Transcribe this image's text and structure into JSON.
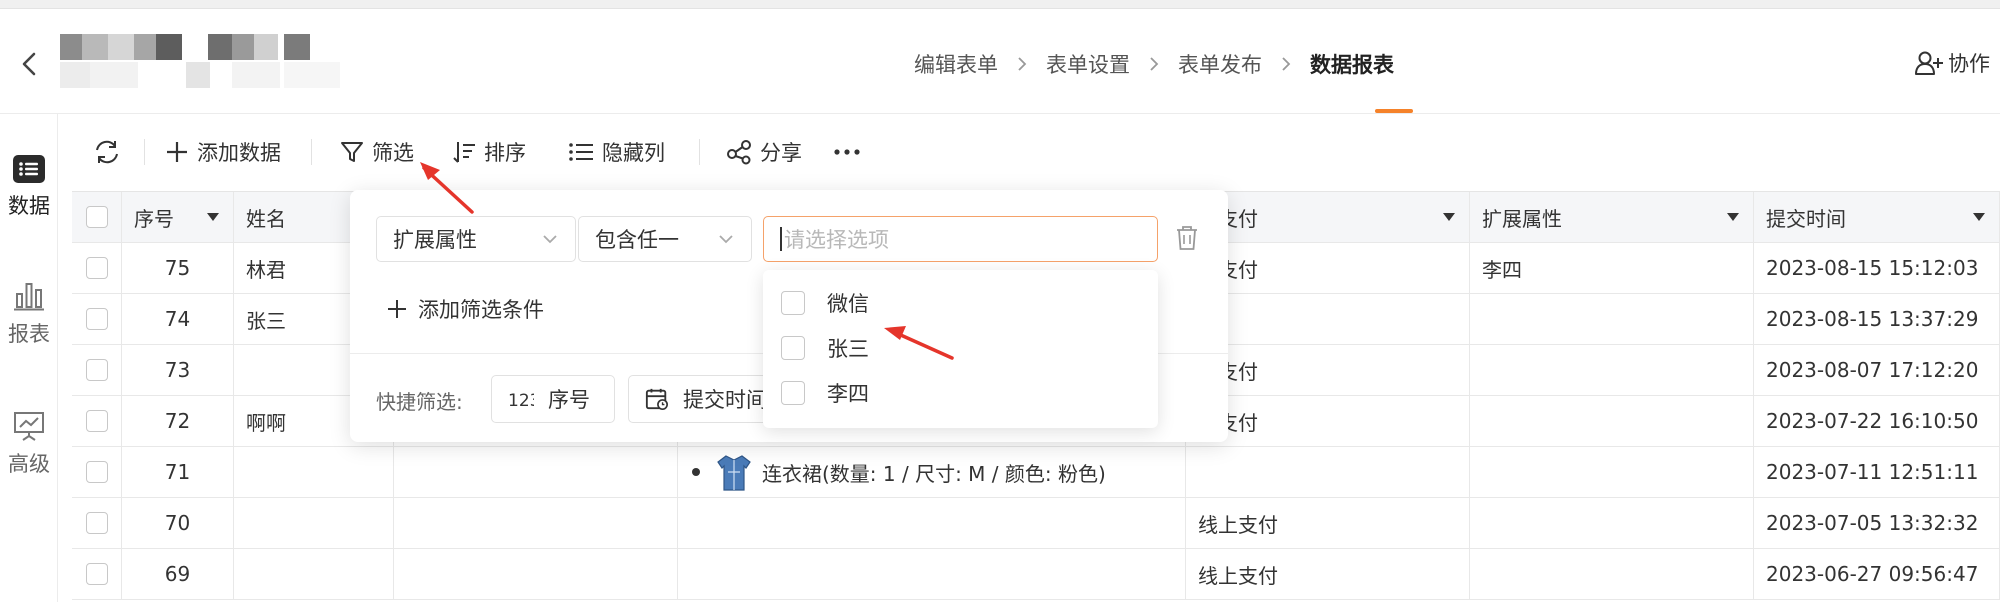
{
  "header": {
    "nav_steps": [
      "编辑表单",
      "表单设置",
      "表单发布",
      "数据报表"
    ],
    "active_step": "数据报表",
    "collab_label": "协作"
  },
  "sidebar": {
    "items": [
      {
        "label": "数据",
        "icon": "list-icon",
        "active": true
      },
      {
        "label": "报表",
        "icon": "bar-chart-icon",
        "active": false
      },
      {
        "label": "高级",
        "icon": "presentation-icon",
        "active": false
      }
    ]
  },
  "toolbar": {
    "add_data": "添加数据",
    "filter": "筛选",
    "sort": "排序",
    "hide_columns": "隐藏列",
    "share": "分享"
  },
  "table": {
    "columns": [
      "序号",
      "姓名",
      "",
      "",
      "何支付",
      "扩展属性",
      "提交时间"
    ],
    "rows": [
      {
        "seq": "75",
        "name": "林君",
        "payment": "下支付",
        "ext": "李四",
        "time": "2023-08-15 15:12:03",
        "order": ""
      },
      {
        "seq": "74",
        "name": "张三",
        "payment": "",
        "ext": "",
        "time": "2023-08-15 13:37:29",
        "order": ""
      },
      {
        "seq": "73",
        "name": "",
        "payment": "下支付",
        "ext": "",
        "time": "2023-08-07 17:12:20",
        "order": ""
      },
      {
        "seq": "72",
        "name": "啊啊",
        "payment": "上支付",
        "ext": "",
        "time": "2023-07-22 16:10:50",
        "order": ""
      },
      {
        "seq": "71",
        "name": "",
        "payment": "",
        "ext": "",
        "time": "2023-07-11 12:51:11",
        "order": "连衣裙(数量: 1 / 尺寸: M / 颜色: 粉色)"
      },
      {
        "seq": "70",
        "name": "",
        "payment": "线上支付",
        "ext": "",
        "time": "2023-07-05 13:32:32",
        "order": ""
      },
      {
        "seq": "69",
        "name": "",
        "payment": "线上支付",
        "ext": "",
        "time": "2023-06-27 09:56:47",
        "order": ""
      }
    ]
  },
  "filter_popover": {
    "field": "扩展属性",
    "operator": "包含任一",
    "value_placeholder": "请选择选项",
    "add_condition": "添加筛选条件",
    "quick_filter_label": "快捷筛选:",
    "quick_buttons": [
      "序号",
      "提交时间"
    ]
  },
  "options_dropdown": {
    "options": [
      "微信",
      "张三",
      "李四"
    ]
  },
  "colors": {
    "accent": "#f5822a",
    "arrow": "#e5352b",
    "focus_border": "#f5a26a"
  }
}
